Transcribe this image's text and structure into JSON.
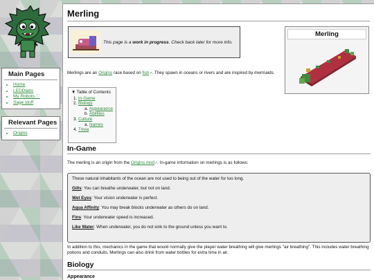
{
  "page_title": "Merling",
  "wip": {
    "prefix": "This page is a ",
    "bold": "work in progress",
    "suffix": ". Check back later for more info."
  },
  "infobox": {
    "title": "Merling"
  },
  "intro": {
    "t1": "Merlings are an ",
    "link1": "Origins",
    "t2": " race based on ",
    "link2": "fish",
    "t3": ". They spawn in oceans or rivers and are inspired by mermaids."
  },
  "toc": {
    "title": "Table of Contents",
    "items": [
      {
        "label": "In-Game"
      },
      {
        "label": "Biology",
        "sub": [
          "Appearance",
          "Abilities"
        ]
      },
      {
        "label": "Culture",
        "sub": [
          "Names"
        ]
      },
      {
        "label": "Trivia"
      }
    ]
  },
  "sidebar": {
    "main_title": "Main Pages",
    "main_items": [
      "Home",
      "LEDDlabs",
      "My Robots ♡",
      "Sage stuff"
    ],
    "relevant_title": "Relevant Pages",
    "relevant_items": [
      "Origins"
    ]
  },
  "ingame": {
    "heading": "In-Game",
    "t1": "The merling is an origin from the ",
    "link": "Origins mod",
    "t2": ". In-game information on merlings is as follows:",
    "quote_intro": "These natural inhabitants of the ocean are not used to being out of the water for too long.",
    "abilities": [
      {
        "name": "Gills",
        "desc": ": You can breathe underwater, but not on land."
      },
      {
        "name": "Wet Eyes",
        "desc": ": Your vision underwater is perfect."
      },
      {
        "name": "Aqua Affinity",
        "desc": ": You may break blocks underwater as others do on land."
      },
      {
        "name": "Fins",
        "desc": ": Your underwater speed is increased."
      },
      {
        "name": "Like Water",
        "desc": ": When underwater, you do not sink to the ground unless you want to."
      }
    ],
    "after": "In addition to this, mechanics in the game that would normally give the player water breathing will give merlings \"air breathing\". This includes water breathing potions and conduits. Merlings can also drink from water bottles for extra time in air."
  },
  "biology": {
    "heading": "Biology",
    "sub": "Appearance"
  },
  "colors": {
    "link": "#2c8a3a",
    "mascot": "#2e6b3c"
  }
}
